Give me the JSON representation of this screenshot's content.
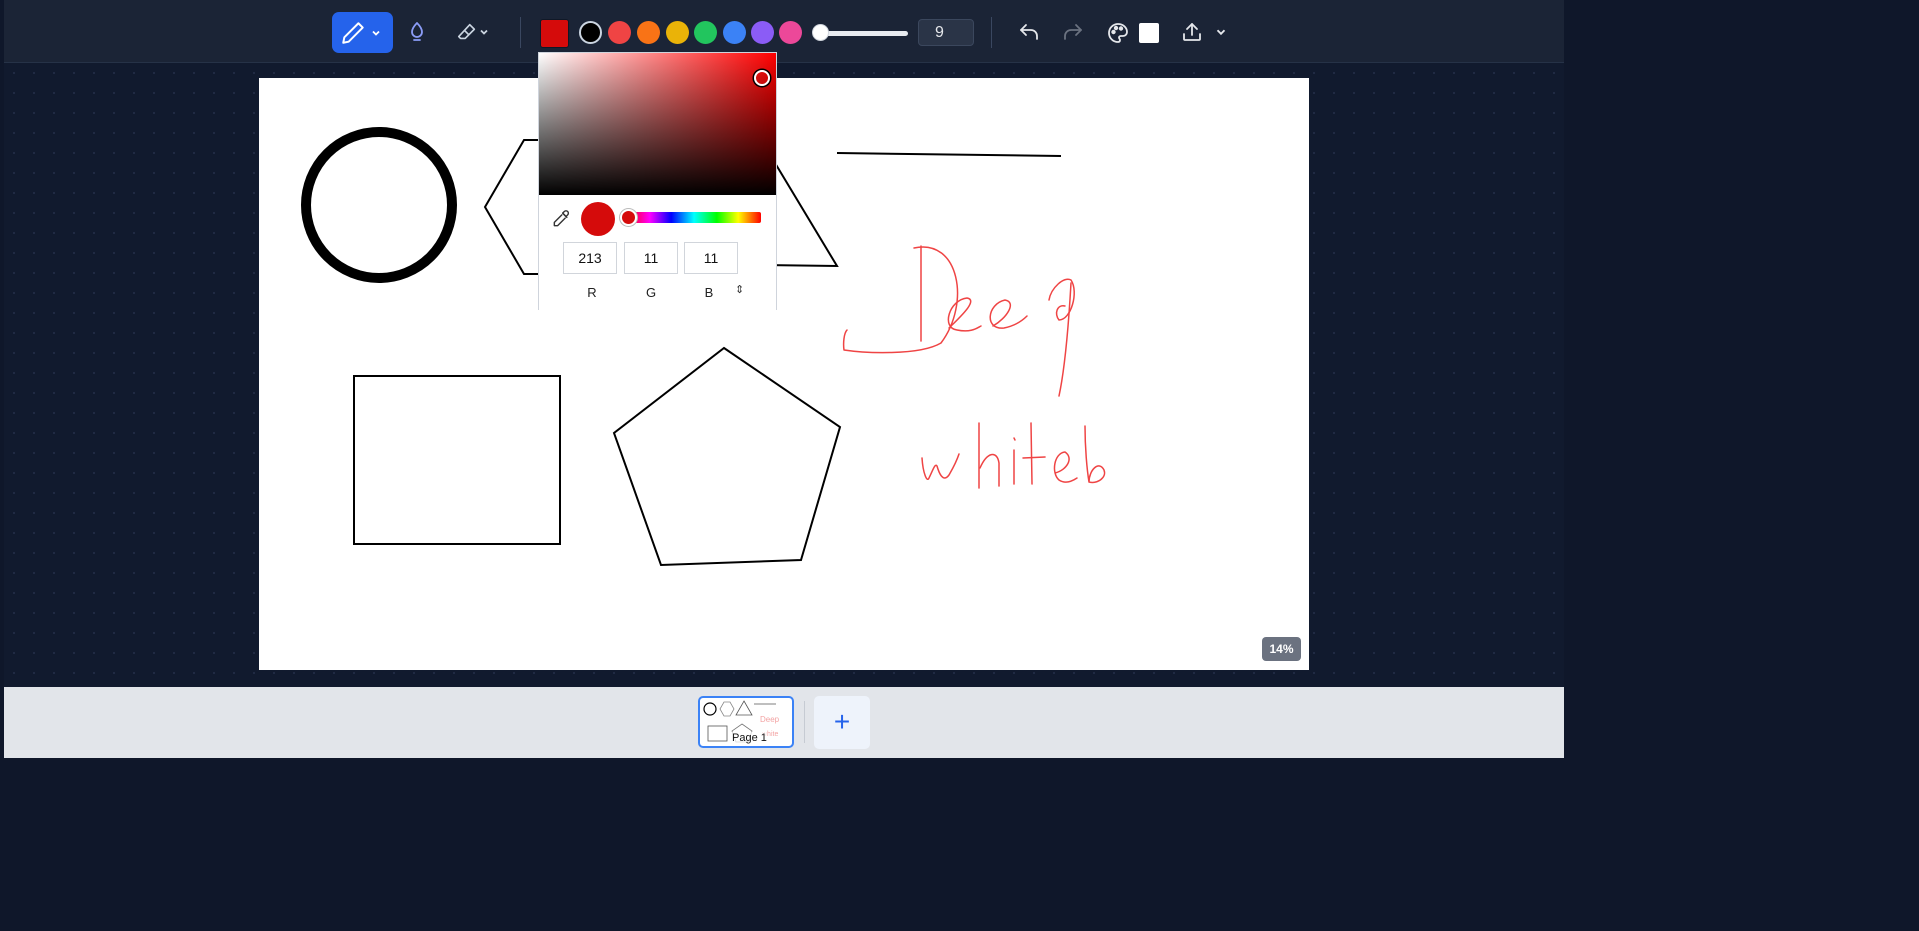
{
  "toolbar": {
    "tools": [
      {
        "name": "pen",
        "active": true
      },
      {
        "name": "highlighter",
        "active": false
      },
      {
        "name": "eraser",
        "active": false
      }
    ],
    "current_color": "#d50b0b",
    "palette": [
      "#000000",
      "#ef4444",
      "#f97316",
      "#eab308",
      "#22c55e",
      "#3b82f6",
      "#8b5cf6",
      "#ec4899"
    ],
    "stroke_size_value": "9",
    "background_color": "#ffffff",
    "icons": [
      "pen-icon",
      "chevron-down-icon",
      "highlighter-icon",
      "eraser-icon",
      "undo-icon",
      "redo-icon",
      "palette-icon",
      "export-icon"
    ]
  },
  "color_picker": {
    "hex": "#d50b0b",
    "r": "213",
    "g": "11",
    "b": "11",
    "label_r": "R",
    "label_g": "G",
    "label_b": "B",
    "mode_toggle": "⇕"
  },
  "canvas": {
    "zoom": "14%",
    "handwriting_color": "#ef4444"
  },
  "pages": {
    "thumbnails": [
      {
        "label": "Page 1",
        "selected": true
      }
    ],
    "add_label": "+"
  }
}
